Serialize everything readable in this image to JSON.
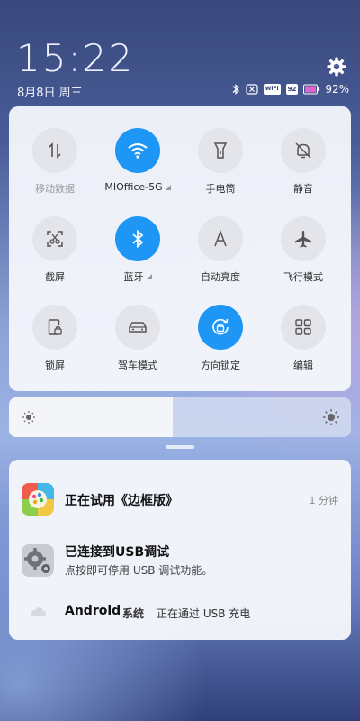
{
  "lockscreen": {
    "time": "15:22",
    "date": "8月8日 周三"
  },
  "status_bar": {
    "wifi_label": "WiFi",
    "signal_label": "92",
    "battery": "92%"
  },
  "quick_settings": {
    "tiles": [
      {
        "label": "移动数据",
        "icon": "mobile-data-icon",
        "active": false,
        "dim": true
      },
      {
        "label": "MIOffice-5G",
        "icon": "wifi-icon",
        "active": true,
        "dim": false
      },
      {
        "label": "手电筒",
        "icon": "flashlight-icon",
        "active": false,
        "dim": false
      },
      {
        "label": "静音",
        "icon": "mute-bell-icon",
        "active": false,
        "dim": false
      },
      {
        "label": "截屏",
        "icon": "screenshot-icon",
        "active": false,
        "dim": false
      },
      {
        "label": "蓝牙",
        "icon": "bluetooth-icon",
        "active": true,
        "dim": false
      },
      {
        "label": "自动亮度",
        "icon": "auto-brightness-icon",
        "active": false,
        "dim": false
      },
      {
        "label": "飞行模式",
        "icon": "airplane-icon",
        "active": false,
        "dim": false
      },
      {
        "label": "锁屏",
        "icon": "lock-screen-icon",
        "active": false,
        "dim": false
      },
      {
        "label": "驾车模式",
        "icon": "car-icon",
        "active": false,
        "dim": false
      },
      {
        "label": "方向锁定",
        "icon": "rotation-lock-icon",
        "active": true,
        "dim": false
      },
      {
        "label": "编辑",
        "icon": "edit-grid-icon",
        "active": false,
        "dim": false
      }
    ],
    "brightness_level": 0.48
  },
  "notifications": [
    {
      "title": "正在试用《边框版》",
      "time": "1 分钟",
      "icon": "theme-app-icon"
    },
    {
      "title": "已连接到USB调试",
      "text": "点按即可停用 USB 调试功能。",
      "icon": "usb-debug-gear-icon"
    },
    {
      "app": "Android",
      "tag": "系统",
      "text": "正在通过 USB 充电",
      "icon": "cloud-icon"
    }
  ],
  "colors": {
    "accent": "#1e96f5",
    "tile_off": "#e3e5ea",
    "panel": "#f4f6fb"
  }
}
